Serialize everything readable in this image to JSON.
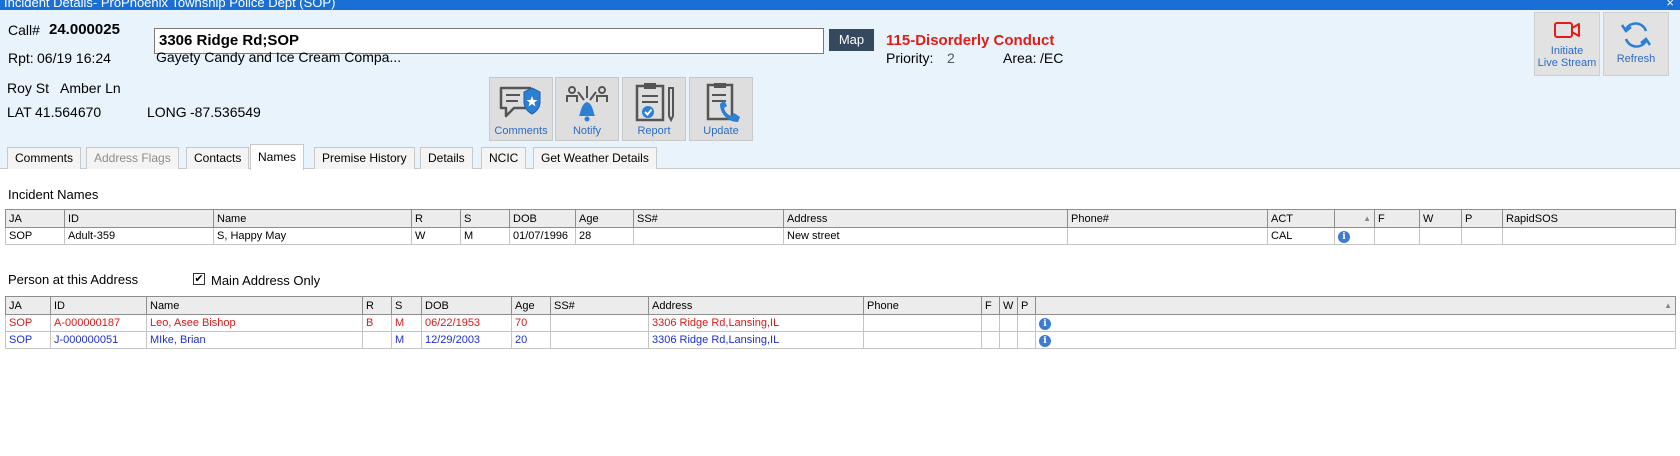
{
  "window": {
    "title": "Incident Details- ProPhoenix Township Police Dept (SOP)",
    "close": "×"
  },
  "header": {
    "call_label": "Call#",
    "call_number": "24.000025",
    "address": "3306 Ridge Rd;SOP",
    "map_label": "Map",
    "nature": "115-Disorderly Conduct",
    "rpt_label": "Rpt:",
    "rpt_time": "06/19 16:24",
    "business": "Gayety Candy and Ice Cream Compa...",
    "priority_label": "Priority:",
    "priority": "2",
    "area_label": "Area:",
    "area": "/EC",
    "live_stream_label_1": "Initiate",
    "live_stream_label_2": "Live Stream",
    "refresh_label": "Refresh"
  },
  "location": {
    "cross_street_1": "Roy St",
    "cross_street_2": "Amber Ln",
    "lat_label": "LAT",
    "lat": "41.564670",
    "long_label": "LONG",
    "long": "-87.536549"
  },
  "actions": {
    "comments": "Comments",
    "notify": "Notify",
    "report": "Report",
    "update": "Update"
  },
  "tabs": [
    "Comments",
    "Address Flags",
    "Contacts",
    "Names",
    "Premise History",
    "Details",
    "NCIC",
    "Get Weather Details"
  ],
  "incident_names": {
    "title": "Incident Names",
    "columns": [
      "JA",
      "ID",
      "Name",
      "R",
      "S",
      "DOB",
      "Age",
      "SS#",
      "Address",
      "Phone#",
      "ACT",
      "",
      "F",
      "W",
      "P",
      "RapidSOS"
    ],
    "sort_marker": "▲",
    "rows": [
      [
        "SOP",
        "Adult-359",
        "S, Happy May",
        "W",
        "M",
        "01/07/1996",
        "28",
        "",
        "New street",
        "",
        "CAL",
        "i",
        "",
        "",
        "",
        ""
      ]
    ]
  },
  "persons": {
    "title": "Person at this Address",
    "main_address_label": "Main Address Only",
    "main_address_checked": "✔",
    "columns": [
      "JA",
      "ID",
      "Name",
      "R",
      "S",
      "DOB",
      "Age",
      "SS#",
      "Address",
      "Phone",
      "F",
      "W",
      "P",
      ""
    ],
    "sort_marker": "▲",
    "rows": [
      [
        "SOP",
        "A-000000187",
        "Leo, Asee Bishop",
        "B",
        "M",
        "06/22/1953",
        "70",
        "",
        "3306 Ridge Rd,Lansing,IL",
        "",
        "",
        "",
        "",
        "i"
      ],
      [
        "SOP",
        "J-000000051",
        "MIke, Brian",
        "",
        "M",
        "12/29/2003",
        "20",
        "",
        "3306 Ridge Rd,Lansing,IL",
        "",
        "",
        "",
        "",
        "i"
      ]
    ]
  },
  "colors": {
    "title_bar": "#1a6fd6",
    "header_bg": "#e8f3fc",
    "nature_red": "#e41b17",
    "map_button": "#34495e",
    "row_red": "#e01515",
    "row_blue": "#1f2fd1"
  }
}
